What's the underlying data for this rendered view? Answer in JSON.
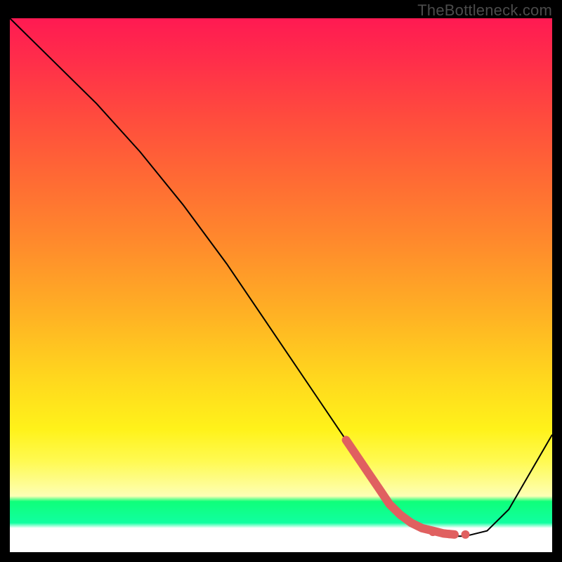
{
  "watermark": "TheBottleneck.com",
  "chart_data": {
    "type": "line",
    "title": "",
    "xlabel": "",
    "ylabel": "",
    "xlim": [
      0,
      100
    ],
    "ylim": [
      0,
      100
    ],
    "series": [
      {
        "name": "bottleneck-curve",
        "x": [
          0,
          8,
          16,
          24,
          32,
          40,
          48,
          56,
          62,
          68,
          72,
          76,
          80,
          84,
          88,
          92,
          100
        ],
        "y": [
          100,
          92,
          84,
          75,
          65,
          54,
          42,
          30,
          21,
          12,
          7,
          4,
          3,
          3,
          4,
          8,
          22
        ],
        "stroke": "#000000",
        "stroke_width": 2
      }
    ],
    "highlight": {
      "name": "optimal-zone-marker",
      "color": "#e06060",
      "points": [
        {
          "x": 62,
          "y": 21
        },
        {
          "x": 64,
          "y": 18
        },
        {
          "x": 66,
          "y": 15
        },
        {
          "x": 68,
          "y": 12
        },
        {
          "x": 70,
          "y": 9
        },
        {
          "x": 72,
          "y": 7
        },
        {
          "x": 74,
          "y": 5.5
        },
        {
          "x": 76,
          "y": 4.5
        },
        {
          "x": 78,
          "y": 4
        },
        {
          "x": 80,
          "y": 3.5
        },
        {
          "x": 82,
          "y": 3.3
        }
      ],
      "dots": [
        {
          "x": 78,
          "y": 3.8
        },
        {
          "x": 81,
          "y": 3.4
        },
        {
          "x": 84,
          "y": 3.3
        }
      ]
    },
    "background_gradient": {
      "top": "#ff1a52",
      "mid": "#ffd61e",
      "green_band": "#10ff88",
      "bottom": "#ffffff"
    }
  }
}
